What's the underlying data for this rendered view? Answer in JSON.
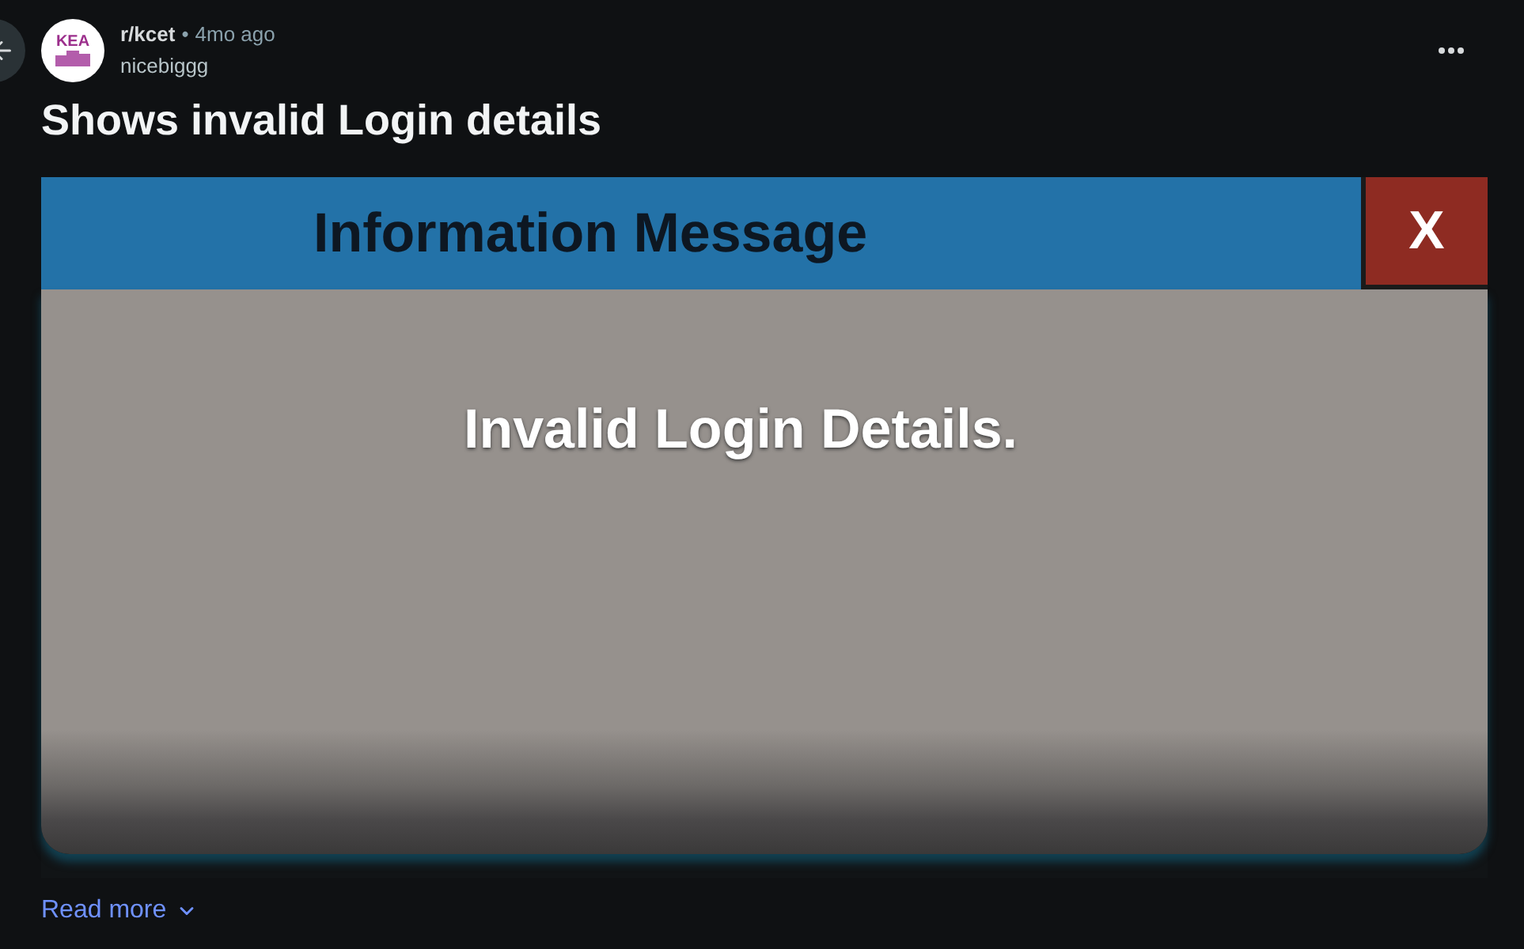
{
  "post": {
    "community": {
      "name": "r/kcet",
      "logo_text": "KEA"
    },
    "separator": "•",
    "time": "4mo ago",
    "author": "nicebiggg",
    "title": "Shows invalid Login details"
  },
  "image": {
    "dialog": {
      "title": "Information Message",
      "close_label": "X",
      "message": "Invalid Login Details."
    }
  },
  "read_more": "Read more"
}
